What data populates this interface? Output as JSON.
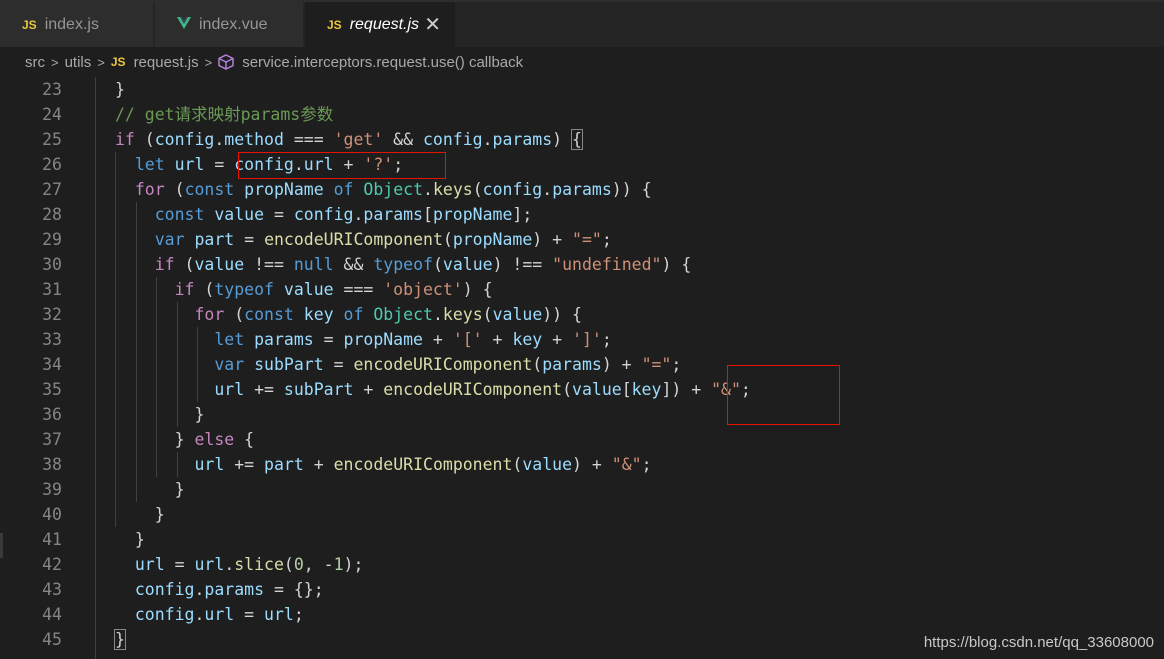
{
  "tabs": [
    {
      "label": "index.js",
      "icon": "js-icon"
    },
    {
      "label": "index.vue",
      "icon": "vue-icon"
    },
    {
      "label": "request.js",
      "icon": "js-icon",
      "active": true,
      "close": "✕"
    }
  ],
  "breadcrumb": {
    "parts": [
      "src",
      "utils",
      "request.js",
      "service.interceptors.request.use() callback"
    ],
    "separator": ">",
    "js_icon_text": "JS"
  },
  "editor": {
    "line_numbers": [
      "23",
      "24",
      "25",
      "26",
      "27",
      "28",
      "29",
      "30",
      "31",
      "32",
      "33",
      "34",
      "35",
      "36",
      "37",
      "38",
      "39",
      "40",
      "41",
      "42",
      "43",
      "44",
      "45"
    ]
  },
  "colors": {
    "keyword": "#569cd6",
    "control": "#c586c0",
    "variable": "#9cdcfe",
    "function": "#dcdcaa",
    "string": "#ce9178",
    "comment": "#6a9955",
    "class": "#4ec9b0",
    "highlight_box": "#e51400"
  },
  "watermark": "https://blog.csdn.net/qq_33608000"
}
